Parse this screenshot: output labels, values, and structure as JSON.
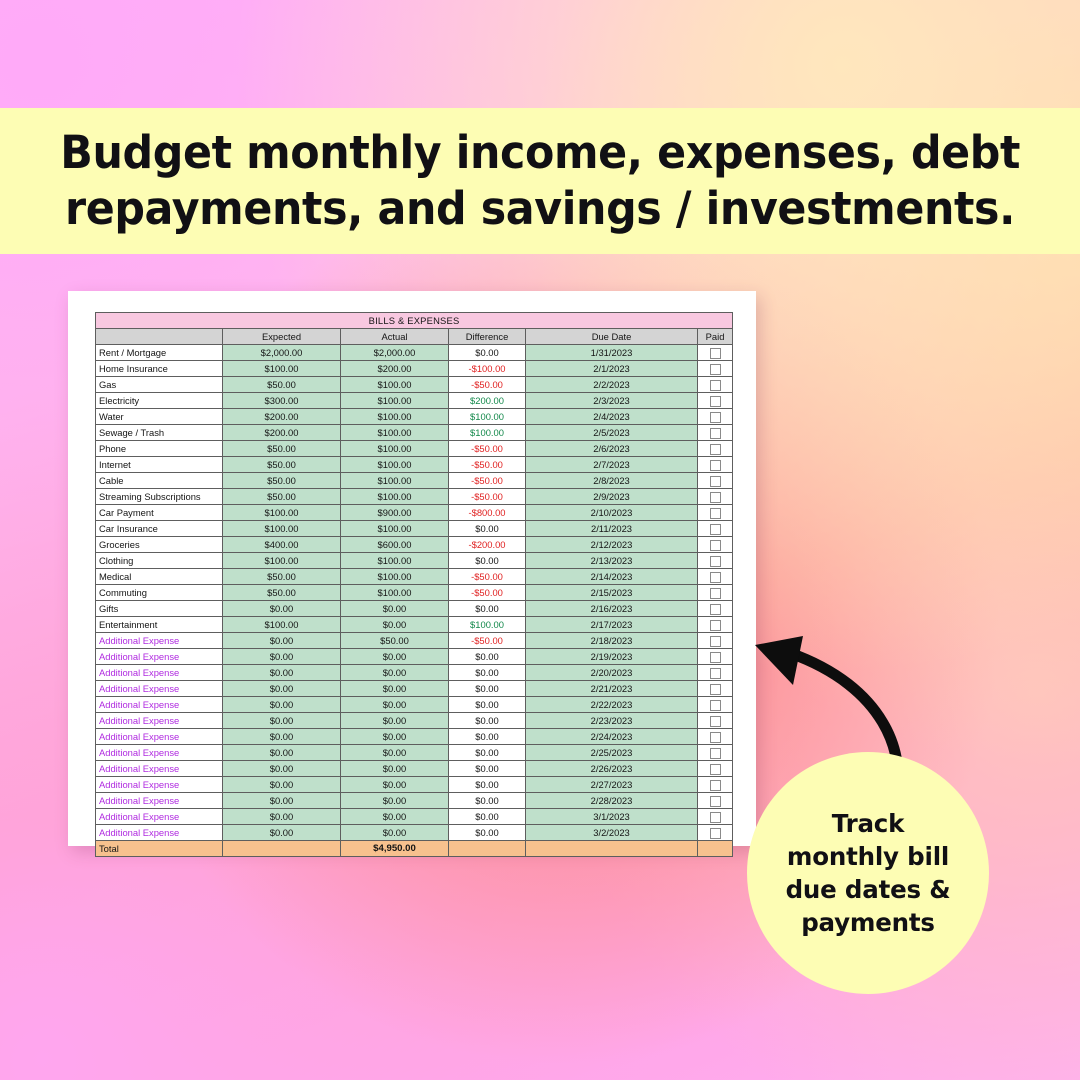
{
  "banner": {
    "line1": "Budget monthly income, expenses, debt",
    "line2": "repayments, and savings / investments."
  },
  "callout": {
    "line1": "Track",
    "line2": "monthly bill",
    "line3": "due dates &",
    "line4": "payments"
  },
  "colors": {
    "banner_bg": "#fdfdb4",
    "title_band": "#f8c8e0",
    "header_bg": "#d4d4d4",
    "money_bg": "#bfe0cb",
    "total_bg": "#f7c18e",
    "negative": "#e02020",
    "positive": "#12884a",
    "extra_label": "#b02ae0"
  },
  "sheet": {
    "title": "BILLS & EXPENSES",
    "columns": [
      "",
      "Expected",
      "Actual",
      "Difference",
      "Due Date",
      "Paid"
    ],
    "rows": [
      {
        "name": "Rent / Mortgage",
        "expected": "$2,000.00",
        "actual": "$2,000.00",
        "difference": "$0.00",
        "diff_sign": "zero",
        "due": "1/31/2023",
        "paid": false,
        "extra": false
      },
      {
        "name": "Home Insurance",
        "expected": "$100.00",
        "actual": "$200.00",
        "difference": "-$100.00",
        "diff_sign": "neg",
        "due": "2/1/2023",
        "paid": false,
        "extra": false
      },
      {
        "name": "Gas",
        "expected": "$50.00",
        "actual": "$100.00",
        "difference": "-$50.00",
        "diff_sign": "neg",
        "due": "2/2/2023",
        "paid": false,
        "extra": false
      },
      {
        "name": "Electricity",
        "expected": "$300.00",
        "actual": "$100.00",
        "difference": "$200.00",
        "diff_sign": "pos",
        "due": "2/3/2023",
        "paid": false,
        "extra": false
      },
      {
        "name": "Water",
        "expected": "$200.00",
        "actual": "$100.00",
        "difference": "$100.00",
        "diff_sign": "pos",
        "due": "2/4/2023",
        "paid": false,
        "extra": false
      },
      {
        "name": "Sewage / Trash",
        "expected": "$200.00",
        "actual": "$100.00",
        "difference": "$100.00",
        "diff_sign": "pos",
        "due": "2/5/2023",
        "paid": false,
        "extra": false
      },
      {
        "name": "Phone",
        "expected": "$50.00",
        "actual": "$100.00",
        "difference": "-$50.00",
        "diff_sign": "neg",
        "due": "2/6/2023",
        "paid": false,
        "extra": false
      },
      {
        "name": "Internet",
        "expected": "$50.00",
        "actual": "$100.00",
        "difference": "-$50.00",
        "diff_sign": "neg",
        "due": "2/7/2023",
        "paid": false,
        "extra": false
      },
      {
        "name": "Cable",
        "expected": "$50.00",
        "actual": "$100.00",
        "difference": "-$50.00",
        "diff_sign": "neg",
        "due": "2/8/2023",
        "paid": false,
        "extra": false
      },
      {
        "name": "Streaming Subscriptions",
        "expected": "$50.00",
        "actual": "$100.00",
        "difference": "-$50.00",
        "diff_sign": "neg",
        "due": "2/9/2023",
        "paid": false,
        "extra": false
      },
      {
        "name": "Car Payment",
        "expected": "$100.00",
        "actual": "$900.00",
        "difference": "-$800.00",
        "diff_sign": "neg",
        "due": "2/10/2023",
        "paid": false,
        "extra": false
      },
      {
        "name": "Car Insurance",
        "expected": "$100.00",
        "actual": "$100.00",
        "difference": "$0.00",
        "diff_sign": "zero",
        "due": "2/11/2023",
        "paid": false,
        "extra": false
      },
      {
        "name": "Groceries",
        "expected": "$400.00",
        "actual": "$600.00",
        "difference": "-$200.00",
        "diff_sign": "neg",
        "due": "2/12/2023",
        "paid": false,
        "extra": false
      },
      {
        "name": "Clothing",
        "expected": "$100.00",
        "actual": "$100.00",
        "difference": "$0.00",
        "diff_sign": "zero",
        "due": "2/13/2023",
        "paid": false,
        "extra": false
      },
      {
        "name": "Medical",
        "expected": "$50.00",
        "actual": "$100.00",
        "difference": "-$50.00",
        "diff_sign": "neg",
        "due": "2/14/2023",
        "paid": false,
        "extra": false
      },
      {
        "name": "Commuting",
        "expected": "$50.00",
        "actual": "$100.00",
        "difference": "-$50.00",
        "diff_sign": "neg",
        "due": "2/15/2023",
        "paid": false,
        "extra": false
      },
      {
        "name": "Gifts",
        "expected": "$0.00",
        "actual": "$0.00",
        "difference": "$0.00",
        "diff_sign": "zero",
        "due": "2/16/2023",
        "paid": false,
        "extra": false
      },
      {
        "name": "Entertainment",
        "expected": "$100.00",
        "actual": "$0.00",
        "difference": "$100.00",
        "diff_sign": "pos",
        "due": "2/17/2023",
        "paid": false,
        "extra": false
      },
      {
        "name": "Additional Expense",
        "expected": "$0.00",
        "actual": "$50.00",
        "difference": "-$50.00",
        "diff_sign": "neg",
        "due": "2/18/2023",
        "paid": false,
        "extra": true
      },
      {
        "name": "Additional Expense",
        "expected": "$0.00",
        "actual": "$0.00",
        "difference": "$0.00",
        "diff_sign": "zero",
        "due": "2/19/2023",
        "paid": false,
        "extra": true
      },
      {
        "name": "Additional Expense",
        "expected": "$0.00",
        "actual": "$0.00",
        "difference": "$0.00",
        "diff_sign": "zero",
        "due": "2/20/2023",
        "paid": false,
        "extra": true
      },
      {
        "name": "Additional Expense",
        "expected": "$0.00",
        "actual": "$0.00",
        "difference": "$0.00",
        "diff_sign": "zero",
        "due": "2/21/2023",
        "paid": false,
        "extra": true
      },
      {
        "name": "Additional Expense",
        "expected": "$0.00",
        "actual": "$0.00",
        "difference": "$0.00",
        "diff_sign": "zero",
        "due": "2/22/2023",
        "paid": false,
        "extra": true
      },
      {
        "name": "Additional Expense",
        "expected": "$0.00",
        "actual": "$0.00",
        "difference": "$0.00",
        "diff_sign": "zero",
        "due": "2/23/2023",
        "paid": false,
        "extra": true
      },
      {
        "name": "Additional Expense",
        "expected": "$0.00",
        "actual": "$0.00",
        "difference": "$0.00",
        "diff_sign": "zero",
        "due": "2/24/2023",
        "paid": false,
        "extra": true
      },
      {
        "name": "Additional Expense",
        "expected": "$0.00",
        "actual": "$0.00",
        "difference": "$0.00",
        "diff_sign": "zero",
        "due": "2/25/2023",
        "paid": false,
        "extra": true
      },
      {
        "name": "Additional Expense",
        "expected": "$0.00",
        "actual": "$0.00",
        "difference": "$0.00",
        "diff_sign": "zero",
        "due": "2/26/2023",
        "paid": false,
        "extra": true
      },
      {
        "name": "Additional Expense",
        "expected": "$0.00",
        "actual": "$0.00",
        "difference": "$0.00",
        "diff_sign": "zero",
        "due": "2/27/2023",
        "paid": false,
        "extra": true
      },
      {
        "name": "Additional Expense",
        "expected": "$0.00",
        "actual": "$0.00",
        "difference": "$0.00",
        "diff_sign": "zero",
        "due": "2/28/2023",
        "paid": false,
        "extra": true
      },
      {
        "name": "Additional Expense",
        "expected": "$0.00",
        "actual": "$0.00",
        "difference": "$0.00",
        "diff_sign": "zero",
        "due": "3/1/2023",
        "paid": false,
        "extra": true
      },
      {
        "name": "Additional Expense",
        "expected": "$0.00",
        "actual": "$0.00",
        "difference": "$0.00",
        "diff_sign": "zero",
        "due": "3/2/2023",
        "paid": false,
        "extra": true
      }
    ],
    "total": {
      "label": "Total",
      "expected": "",
      "actual": "$4,950.00",
      "difference": "",
      "due": "",
      "paid": ""
    }
  }
}
